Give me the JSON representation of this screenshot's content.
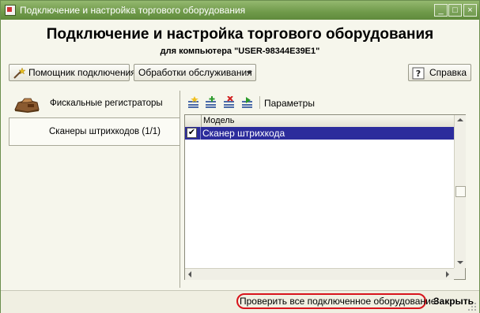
{
  "window": {
    "title": "Подключение и настройка торгового оборудования"
  },
  "header": {
    "title": "Подключение и настройка торгового оборудования",
    "subtitle": "для компьютера \"USER-98344E39E1\""
  },
  "toolbar": {
    "wizard_label": "Помощник подключения",
    "service_label": "Обработки обслуживания",
    "help_label": "Справка"
  },
  "tabs": [
    {
      "label": "Фискальные регистраторы",
      "icon": "fiscal-register-icon"
    },
    {
      "label": "Сканеры штрихкодов (1/1)",
      "icon": ""
    }
  ],
  "list_toolbar": {
    "params_label": "Параметры",
    "icons": [
      "add-icon",
      "add-copy-icon",
      "delete-icon",
      "set-icon"
    ]
  },
  "table": {
    "columns": [
      "Модель"
    ],
    "rows": [
      {
        "checked": true,
        "model": "Сканер штрихкода"
      }
    ]
  },
  "statusbar": {
    "check_all_label": "Проверить все подключенное оборудование",
    "close_label": "Закрыть"
  },
  "colors": {
    "title_bar": "#6f9a4a",
    "selection": "#2c2c9c",
    "highlight_ring": "#d8141c",
    "window_bg": "#f6f6ec"
  }
}
